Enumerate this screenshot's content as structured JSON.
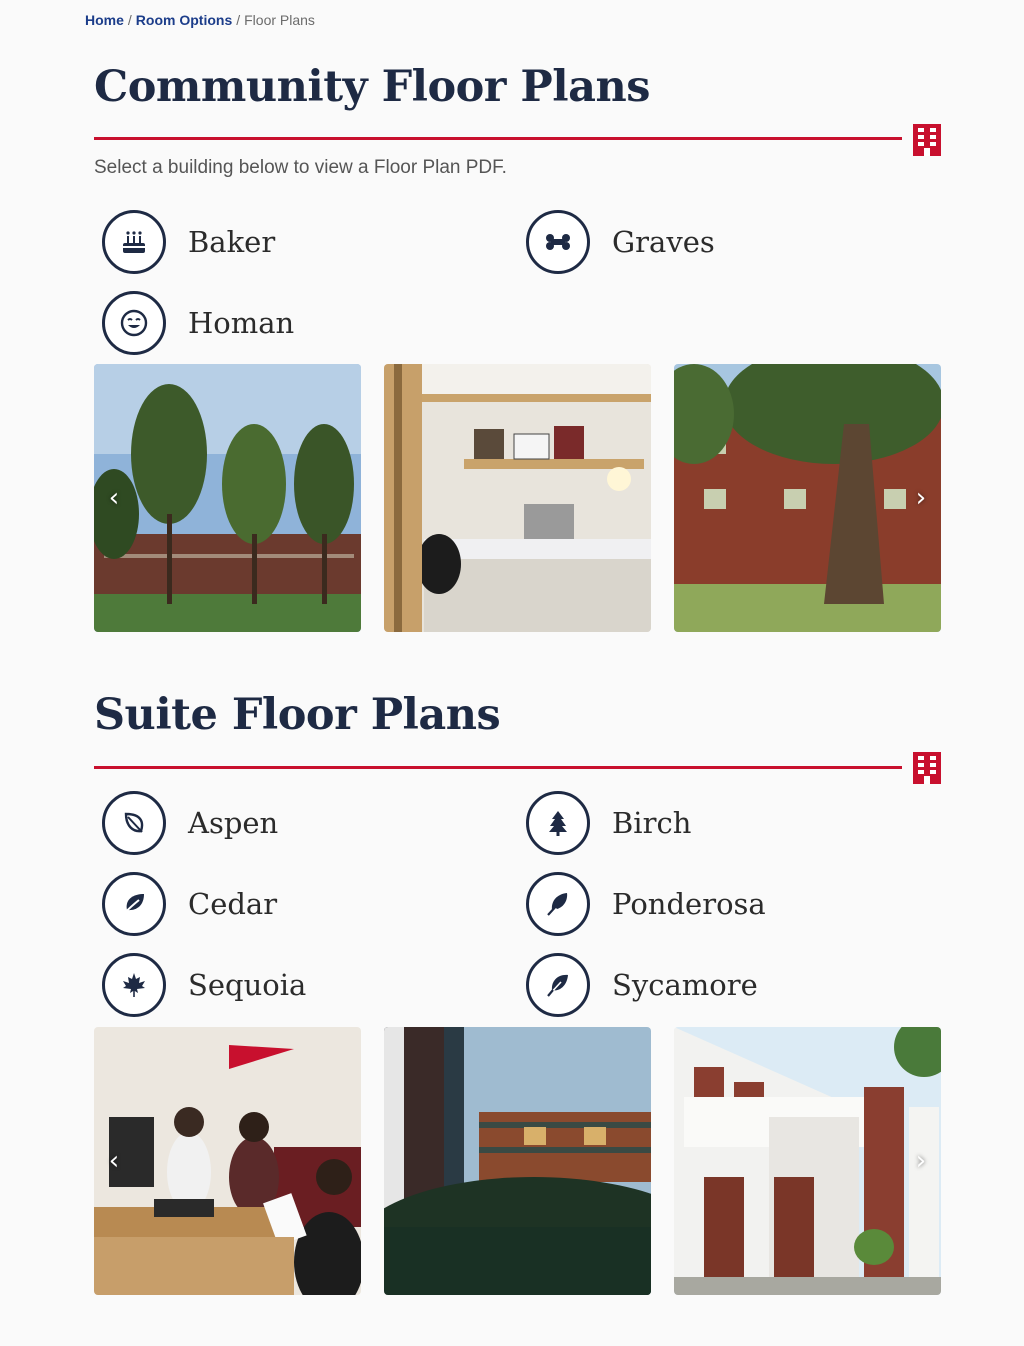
{
  "breadcrumb": {
    "home": "Home",
    "sep1": "/",
    "room_options": "Room Options",
    "sep2": "/",
    "current": "Floor Plans"
  },
  "community": {
    "title": "Community Floor Plans",
    "intro": "Select a building below to view a Floor Plan PDF.",
    "buildings": [
      {
        "label": "Baker",
        "icon": "birthday-cake-icon"
      },
      {
        "label": "Graves",
        "icon": "bone-icon"
      },
      {
        "label": "Homan",
        "icon": "smile-icon"
      }
    ],
    "photos": [
      "trees-and-dorm-photo",
      "dorm-desk-photo",
      "brick-dorm-tree-photo"
    ]
  },
  "suite": {
    "title": "Suite Floor Plans",
    "buildings": [
      {
        "label": "Aspen",
        "icon": "leaf-icon"
      },
      {
        "label": "Birch",
        "icon": "tree-icon"
      },
      {
        "label": "Cedar",
        "icon": "leaf-solid-icon"
      },
      {
        "label": "Ponderosa",
        "icon": "feather-icon"
      },
      {
        "label": "Sequoia",
        "icon": "maple-leaf-icon"
      },
      {
        "label": "Sycamore",
        "icon": "feather-alt-icon"
      }
    ],
    "photos": [
      "students-studying-photo",
      "suite-building-dusk-photo",
      "suite-building-white-photo"
    ]
  },
  "colors": {
    "navy": "#1e2a44",
    "accent_red": "#c8102e",
    "link_blue": "#1c3d8a"
  },
  "carousel": {
    "prev": "‹",
    "next": "›"
  }
}
